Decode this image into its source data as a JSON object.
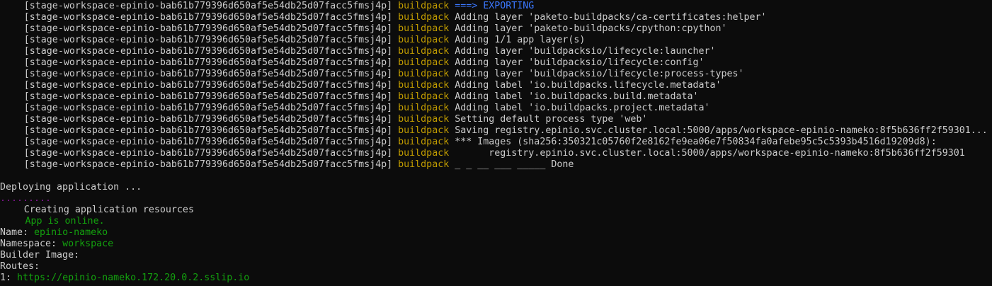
{
  "terminal": {
    "log_glyph": "⠀",
    "log_lines": [
      {
        "pod": "[stage-workspace-epinio-bab61b779396d650af5e54db25d07facc5fmsj4p]",
        "source": "buildpack",
        "arrow": "===> EXPORTING",
        "message": ""
      },
      {
        "pod": "[stage-workspace-epinio-bab61b779396d650af5e54db25d07facc5fmsj4p]",
        "source": "buildpack",
        "arrow": "",
        "message": "Adding layer 'paketo-buildpacks/ca-certificates:helper'"
      },
      {
        "pod": "[stage-workspace-epinio-bab61b779396d650af5e54db25d07facc5fmsj4p]",
        "source": "buildpack",
        "arrow": "",
        "message": "Adding layer 'paketo-buildpacks/cpython:cpython'"
      },
      {
        "pod": "[stage-workspace-epinio-bab61b779396d650af5e54db25d07facc5fmsj4p]",
        "source": "buildpack",
        "arrow": "",
        "message": "Adding 1/1 app layer(s)"
      },
      {
        "pod": "[stage-workspace-epinio-bab61b779396d650af5e54db25d07facc5fmsj4p]",
        "source": "buildpack",
        "arrow": "",
        "message": "Adding layer 'buildpacksio/lifecycle:launcher'"
      },
      {
        "pod": "[stage-workspace-epinio-bab61b779396d650af5e54db25d07facc5fmsj4p]",
        "source": "buildpack",
        "arrow": "",
        "message": "Adding layer 'buildpacksio/lifecycle:config'"
      },
      {
        "pod": "[stage-workspace-epinio-bab61b779396d650af5e54db25d07facc5fmsj4p]",
        "source": "buildpack",
        "arrow": "",
        "message": "Adding layer 'buildpacksio/lifecycle:process-types'"
      },
      {
        "pod": "[stage-workspace-epinio-bab61b779396d650af5e54db25d07facc5fmsj4p]",
        "source": "buildpack",
        "arrow": "",
        "message": "Adding label 'io.buildpacks.lifecycle.metadata'"
      },
      {
        "pod": "[stage-workspace-epinio-bab61b779396d650af5e54db25d07facc5fmsj4p]",
        "source": "buildpack",
        "arrow": "",
        "message": "Adding label 'io.buildpacks.build.metadata'"
      },
      {
        "pod": "[stage-workspace-epinio-bab61b779396d650af5e54db25d07facc5fmsj4p]",
        "source": "buildpack",
        "arrow": "",
        "message": "Adding label 'io.buildpacks.project.metadata'"
      },
      {
        "pod": "[stage-workspace-epinio-bab61b779396d650af5e54db25d07facc5fmsj4p]",
        "source": "buildpack",
        "arrow": "",
        "message": "Setting default process type 'web'"
      },
      {
        "pod": "[stage-workspace-epinio-bab61b779396d650af5e54db25d07facc5fmsj4p]",
        "source": "buildpack",
        "arrow": "",
        "message": "Saving registry.epinio.svc.cluster.local:5000/apps/workspace-epinio-nameko:8f5b636ff2f59301..."
      },
      {
        "pod": "[stage-workspace-epinio-bab61b779396d650af5e54db25d07facc5fmsj4p]",
        "source": "buildpack",
        "arrow": "",
        "message": "*** Images (sha256:350321c05760f2e8162fe9ea06e7f50834fa0afebe95c5c5393b4516d19209d8):"
      },
      {
        "pod": "[stage-workspace-epinio-bab61b779396d650af5e54db25d07facc5fmsj4p]",
        "source": "buildpack",
        "arrow": "",
        "message": "      registry.epinio.svc.cluster.local:5000/apps/workspace-epinio-nameko:8f5b636ff2f59301"
      },
      {
        "pod": "[stage-workspace-epinio-bab61b779396d650af5e54db25d07facc5fmsj4p]",
        "source": "buildpack",
        "arrow": "",
        "message": "_ _ __ ___ _____ Done"
      }
    ],
    "deploying_text": "Deploying application ...",
    "spinner_dots": ".........",
    "creating_glyph": "⠀",
    "creating_text": "Creating application resources",
    "online_glyph": "⠀⠀",
    "online_text": "App is online.",
    "name_label": "Name:",
    "name_value": "epinio-nameko",
    "namespace_label": "Namespace:",
    "namespace_value": "workspace",
    "builder_label": "Builder Image:",
    "routes_label": "Routes:",
    "route_index": "1:",
    "route_url": "https://epinio-nameko.172.20.0.2.sslip.io"
  },
  "colors": {
    "background": "#0c0c0c",
    "foreground": "#cccccc",
    "yellow": "#c19c00",
    "blue": "#3b78ff",
    "green": "#13a10e",
    "magenta": "#881798"
  }
}
